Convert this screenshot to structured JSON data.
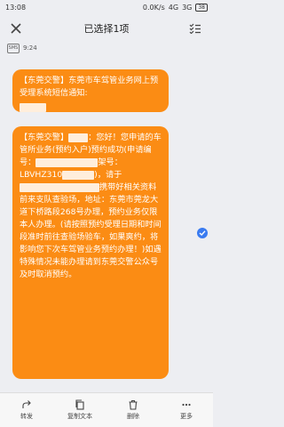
{
  "status_bar": {
    "time": "13:08",
    "network_speed": "0.0K/s",
    "signal_1": "4G",
    "signal_2": "3G",
    "battery": "38"
  },
  "header": {
    "title": "已选择1项"
  },
  "thread": {
    "sms_badge": "SMS",
    "timestamp": "9:24",
    "messages": [
      {
        "text": "【东莞交警】东莞市车驾管业务网上预受理系统短信通知:"
      },
      {
        "part1": "【东莞交警】",
        "part2": "：您好！您申请的车管所业务(预约入户)预约成功(申请编号：",
        "part3": "架号：",
        "vin_prefix": "LBVHZ310",
        "part4": ")，请于",
        "part5": "携带好相关资料前来支队查验场，地址：东莞市莞龙大道下桥路段268号办理，预约业务仅限本人办理。(请按照预约受理日期和时间段准时前往查验场验车，如果爽约，将影响您下次车驾管业务预约办理！)如遇特殊情况未能办理请到东莞交警公众号及时取消预约。"
      }
    ]
  },
  "bottom_actions": [
    {
      "label": "转发",
      "icon": "forward-icon"
    },
    {
      "label": "复制文本",
      "icon": "copy-icon"
    },
    {
      "label": "删除",
      "icon": "delete-icon"
    },
    {
      "label": "更多",
      "icon": "more-icon"
    }
  ]
}
